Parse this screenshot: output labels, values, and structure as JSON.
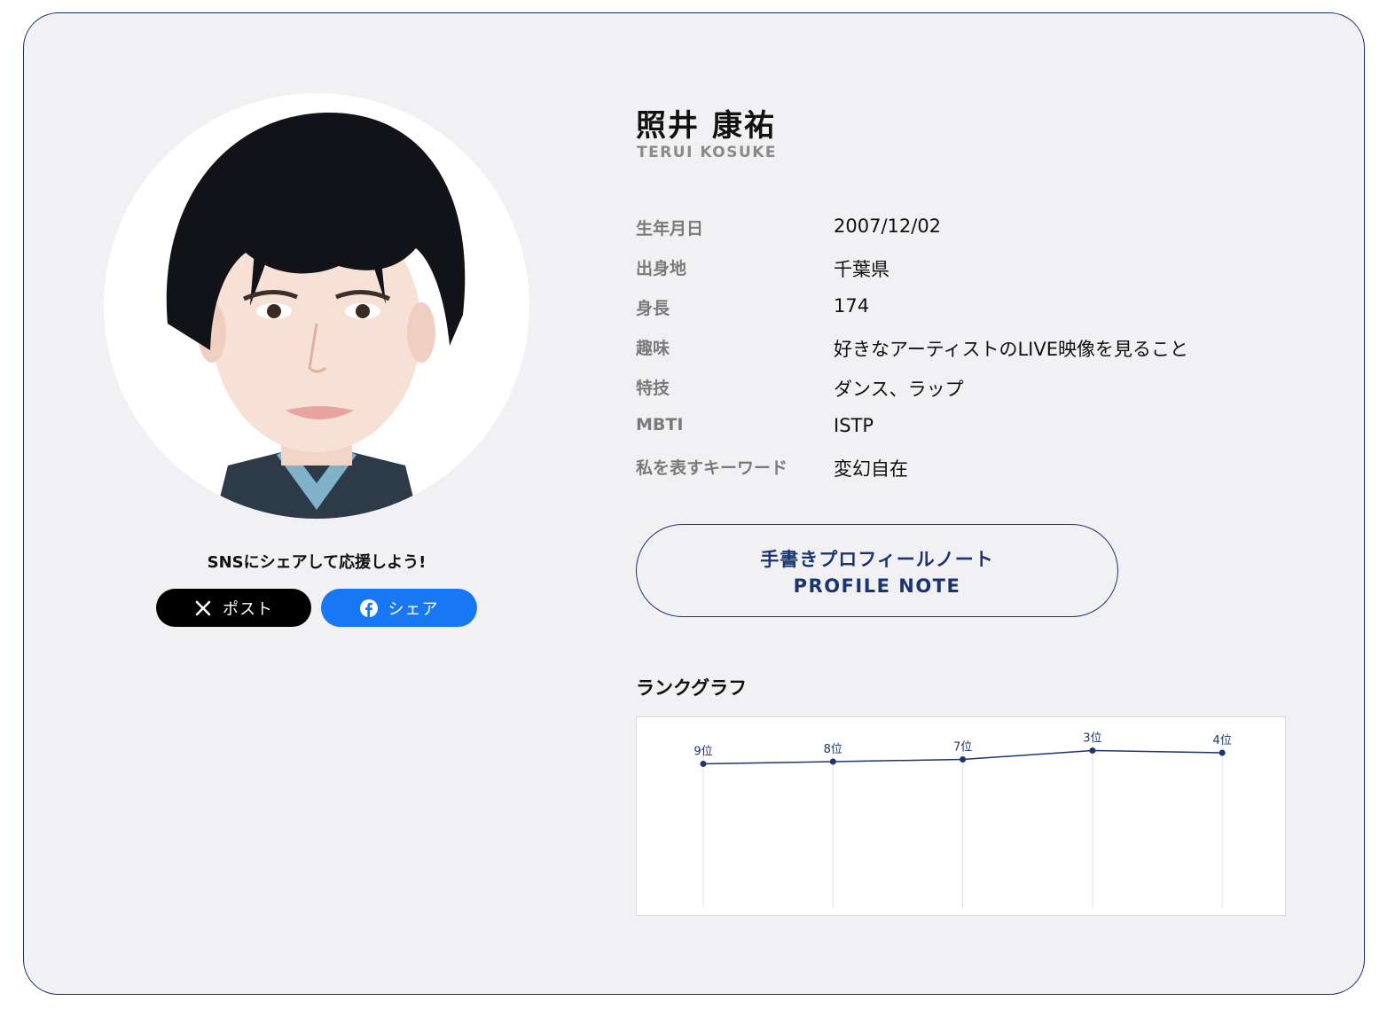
{
  "profile": {
    "name": "照井 康祐",
    "name_en": "TERUI KOSUKE"
  },
  "info": [
    {
      "label": "生年月日",
      "value": "2007/12/02"
    },
    {
      "label": "出身地",
      "value": "千葉県"
    },
    {
      "label": "身長",
      "value": "174"
    },
    {
      "label": "趣味",
      "value": "好きなアーティストのLIVE映像を見ること"
    },
    {
      "label": "特技",
      "value": "ダンス、ラップ"
    },
    {
      "label": "MBTI",
      "value": "ISTP"
    },
    {
      "label": "私を表すキーワード",
      "value": "変幻自在"
    }
  ],
  "share": {
    "caption": "SNSにシェアして応援しよう!",
    "x_label": "ポスト",
    "fb_label": "シェア",
    "x_icon": "x-logo-icon",
    "fb_icon": "facebook-icon"
  },
  "note_button": {
    "label_jp": "手書きプロフィールノート",
    "label_en": "PROFILE NOTE"
  },
  "rank_graph": {
    "title": "ランクグラフ"
  },
  "colors": {
    "accent": "#1e3470",
    "background": "#f1f1f4",
    "x_button": "#000000",
    "fb_button": "#1877f2"
  },
  "chart_data": {
    "type": "line",
    "title": "ランクグラフ",
    "categories": [
      "",
      "",
      "",
      "",
      ""
    ],
    "values": [
      9,
      8,
      7,
      3,
      4
    ],
    "labels": [
      "9位",
      "8位",
      "7位",
      "3位",
      "4位"
    ],
    "grid": "vertical"
  }
}
